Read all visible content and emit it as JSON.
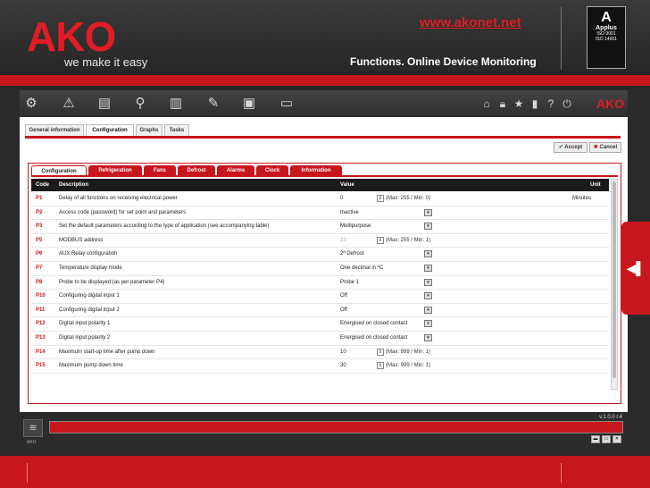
{
  "slide": {
    "brand": "AKO",
    "tagline": "we make it easy",
    "url": "www.akonet.net",
    "subtitle": "Functions. Online Device Monitoring",
    "cert": {
      "mark": "A",
      "name": "Applus",
      "lines": [
        "ISO 9001",
        "ISO 14001"
      ]
    }
  },
  "toolbar": {
    "icons": [
      "gear-icon",
      "warning-icon",
      "printer-icon",
      "search-icon",
      "chart-icon",
      "edit-icon",
      "image-icon",
      "folder-icon"
    ],
    "right_icons": [
      "home-icon",
      "lock-icon",
      "star-icon",
      "device-icon",
      "help-icon",
      "power-icon"
    ],
    "logo": "AKO"
  },
  "main_tabs": [
    "General information",
    "Configuration",
    "Graphs",
    "Tasks"
  ],
  "main_tab_active": "Configuration",
  "actions": {
    "accept": "Accept",
    "cancel": "Cancel"
  },
  "sub_tabs": [
    "Configuration",
    "Refrigeration",
    "Fans",
    "Defrost",
    "Alarms",
    "Clock",
    "Information"
  ],
  "sub_tab_active": "Configuration",
  "grid": {
    "headers": {
      "code": "Code",
      "description": "Description",
      "value": "Value",
      "unit": "Unit"
    },
    "rows": [
      {
        "code": "P1",
        "description": "Delay of all functions on receiving electrical power",
        "value": "0",
        "range": "(Max: 255 / Min: 0)",
        "unit": "Minutes"
      },
      {
        "code": "P2",
        "description": "Access code (password) for set point and parameters",
        "value": "Inactive",
        "dropdown": true
      },
      {
        "code": "P3",
        "description": "Set the default parameters according to the type of application (see accompanying table)",
        "value": "Multipurpose",
        "dropdown": true
      },
      {
        "code": "P5",
        "description": "MODBUS address",
        "value": "23",
        "range": "(Max: 255 / Min: 1)",
        "disabled": true
      },
      {
        "code": "P6",
        "description": "AUX Relay configuration",
        "value": "2ª Defrost",
        "dropdown": true
      },
      {
        "code": "P7",
        "description": "Temperature display mode",
        "value": "One decimal in ºC",
        "dropdown": true
      },
      {
        "code": "P8",
        "description": "Probe to be displayed (as per parameter P4)",
        "value": "Probe 1",
        "dropdown": true
      },
      {
        "code": "P10",
        "description": "Configuring digital input 1",
        "value": "Off",
        "dropdown": true
      },
      {
        "code": "P11",
        "description": "Configuring digital input 2",
        "value": "Off",
        "dropdown": true
      },
      {
        "code": "P12",
        "description": "Digital input polarity 1",
        "value": "Energised on closed contact",
        "dropdown": true
      },
      {
        "code": "P13",
        "description": "Digital input polarity 2",
        "value": "Energised on closed contact",
        "dropdown": true
      },
      {
        "code": "P14",
        "description": "Maximum start-up time after pump down",
        "value": "10",
        "range": "(Max: 999 / Min: 1)"
      },
      {
        "code": "P15",
        "description": "Maximum pump down time",
        "value": "30",
        "range": "(Max: 999 / Min: 1)"
      }
    ]
  },
  "status": {
    "version": "v.1.0.0 r.4",
    "wifi_label": "AKO"
  }
}
